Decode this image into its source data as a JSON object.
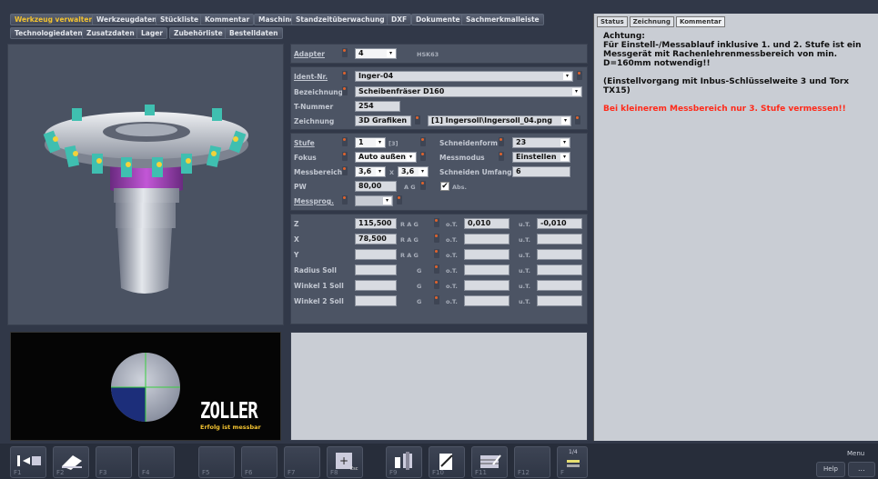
{
  "tabs_row1": [
    "Werkzeug verwalten",
    "Werkzeugdaten",
    "Stückliste",
    "Kommentar",
    "Maschine",
    "Standzeitüberwachung",
    "DXF",
    "Dokumente",
    "Sachmerkmalleiste"
  ],
  "tabs_row2": [
    "Technologiedaten",
    "Zusatzdaten",
    "Lager",
    "Zubehörliste",
    "Bestelldaten"
  ],
  "adapter": {
    "label": "Adapter",
    "value": "4",
    "type": "HSK63"
  },
  "ident": {
    "label": "Ident-Nr.",
    "value": "Inger-04"
  },
  "bezeichnung": {
    "label": "Bezeichnung",
    "value": "Scheibenfräser D160"
  },
  "tnummer": {
    "label": "T-Nummer",
    "value": "254"
  },
  "zeichnung": {
    "label": "Zeichnung",
    "value": "3D Grafiken",
    "file": "[1] Ingersoll\\Ingersoll_04.png"
  },
  "stufe": {
    "label": "Stufe",
    "value": "1",
    "total": "[3]"
  },
  "schneidenform": {
    "label": "Schneidenform",
    "value": "23"
  },
  "fokus": {
    "label": "Fokus",
    "value": "Auto außen"
  },
  "messmodus": {
    "label": "Messmodus",
    "value": "Einstellen"
  },
  "messbereich": {
    "label": "Messbereich",
    "value1": "3,6",
    "sep": "X",
    "value2": "3,6"
  },
  "schneiden_umfang": {
    "label": "Schneiden Umfang",
    "value": "6"
  },
  "pw": {
    "label": "PW",
    "value": "80,00",
    "ag": "A G",
    "abs_label": "Abs.",
    "abs_checked": "✔"
  },
  "messprog": {
    "label": "Messprog."
  },
  "measure_rows": [
    {
      "label": "Z",
      "value": "115,500",
      "rag": "R A G",
      "ot_label": "o.T.",
      "ot": "0,010",
      "ut_label": "u.T.",
      "ut": "-0,010"
    },
    {
      "label": "X",
      "value": "78,500",
      "rag": "R A G",
      "ot_label": "o.T.",
      "ot": "",
      "ut_label": "u.T.",
      "ut": ""
    },
    {
      "label": "Y",
      "value": "",
      "rag": "R A G",
      "ot_label": "o.T.",
      "ot": "",
      "ut_label": "u.T.",
      "ut": ""
    },
    {
      "label": "Radius Soll",
      "value": "",
      "rag": "G",
      "ot_label": "o.T.",
      "ot": "",
      "ut_label": "u.T.",
      "ut": ""
    },
    {
      "label": "Winkel 1 Soll",
      "value": "",
      "rag": "G",
      "ot_label": "o.T.",
      "ot": "",
      "ut_label": "u.T.",
      "ut": ""
    },
    {
      "label": "Winkel 2 Soll",
      "value": "",
      "rag": "G",
      "ot_label": "o.T.",
      "ot": "",
      "ut_label": "u.T.",
      "ut": ""
    }
  ],
  "right_tabs": [
    "Status",
    "Zeichnung",
    "Kommentar"
  ],
  "comment": {
    "heading": "Achtung:",
    "line1": "Für Einstell-/Messablauf inklusive 1. und 2. Stufe ist ein Messgerät mit Rachenlehrenmessbereich von min. D=160mm notwendig!!",
    "line2": "(Einstellvorgang mit Inbus-Schlüsselweite 3 und Torx TX15)",
    "warning": "Bei kleinerem Messbereich nur 3. Stufe vermessen!!",
    "warning_color": "#ff2a1a"
  },
  "logo": {
    "brand": "ZOLLER",
    "slogan": "Erfolg ist messbar"
  },
  "fkeys": [
    "F1",
    "F2",
    "F3",
    "F4",
    "F5",
    "F6",
    "F7",
    "F8",
    "F9",
    "F10",
    "F11",
    "F12",
    "F"
  ],
  "f8_sub": "Esc",
  "page_indicator": "1/4",
  "bottom_right": {
    "menu": "Menu",
    "help": "Help",
    "more": "..."
  },
  "colors": {
    "accent": "#f2c230",
    "background": "#313848",
    "panel": "#4c5464",
    "comment_bg": "#c9cdd4"
  }
}
